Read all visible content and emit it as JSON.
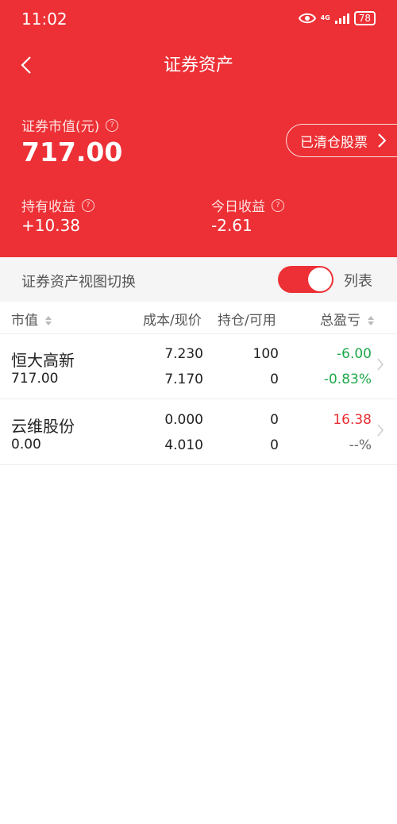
{
  "status": {
    "time": "11:02",
    "network": "4G",
    "battery": "78"
  },
  "nav": {
    "title": "证券资产"
  },
  "summary": {
    "market_value_label": "证券市值(元)",
    "market_value": "717.00",
    "cleared_stocks_label": "已清仓股票",
    "holding_profit_label": "持有收益",
    "holding_profit": "+10.38",
    "today_profit_label": "今日收益",
    "today_profit": "-2.61"
  },
  "view_switch": {
    "label": "证券资产视图切换",
    "toggle_on": true,
    "mode_label": "列表"
  },
  "columns": {
    "market_value": "市值",
    "cost_price": "成本/现价",
    "position": "持仓/可用",
    "total_pl": "总盈亏"
  },
  "rows": [
    {
      "name": "恒大高新",
      "market_value": "717.00",
      "cost": "7.230",
      "price": "7.170",
      "holding": "100",
      "available": "0",
      "pl": "-6.00",
      "pl_pct": "-0.83%"
    },
    {
      "name": "云维股份",
      "market_value": "0.00",
      "cost": "0.000",
      "price": "4.010",
      "holding": "0",
      "available": "0",
      "pl": "16.38",
      "pl_pct": "--%"
    }
  ],
  "colors": {
    "brand_red": "#ec3035",
    "loss_green": "#1ea84a",
    "gain_red": "#e72d33"
  }
}
